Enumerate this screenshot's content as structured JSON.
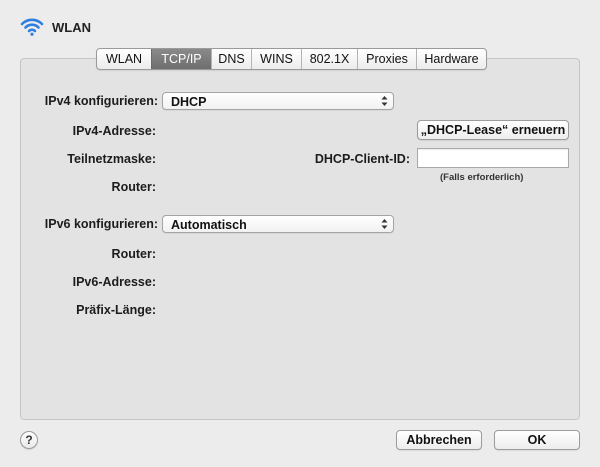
{
  "window": {
    "title": "WLAN",
    "icon": "wifi-icon"
  },
  "tabs": [
    {
      "label": "WLAN",
      "active": false
    },
    {
      "label": "TCP/IP",
      "active": true
    },
    {
      "label": "DNS",
      "active": false
    },
    {
      "label": "WINS",
      "active": false
    },
    {
      "label": "802.1X",
      "active": false
    },
    {
      "label": "Proxies",
      "active": false
    },
    {
      "label": "Hardware",
      "active": false
    }
  ],
  "ipv4": {
    "configure_label": "IPv4 konfigurieren:",
    "configure_value": "DHCP",
    "address_label": "IPv4-Adresse:",
    "subnet_label": "Teilnetzmaske:",
    "router_label": "Router:",
    "renew_button": "„DHCP-Lease“ erneuern",
    "client_id_label": "DHCP-Client-ID:",
    "client_id_value": "",
    "client_id_note": "(Falls erforderlich)"
  },
  "ipv6": {
    "configure_label": "IPv6 konfigurieren:",
    "configure_value": "Automatisch",
    "router_label": "Router:",
    "address_label": "IPv6-Adresse:",
    "prefix_label": "Präfix-Länge:"
  },
  "footer": {
    "help_label": "?",
    "cancel_button": "Abbrechen",
    "ok_button": "OK"
  },
  "colors": {
    "window_bg": "#ececec",
    "panel_bg": "#e3e3e3",
    "active_tab": "#7b7b7b",
    "wifi_icon": "#2f7fe0"
  }
}
